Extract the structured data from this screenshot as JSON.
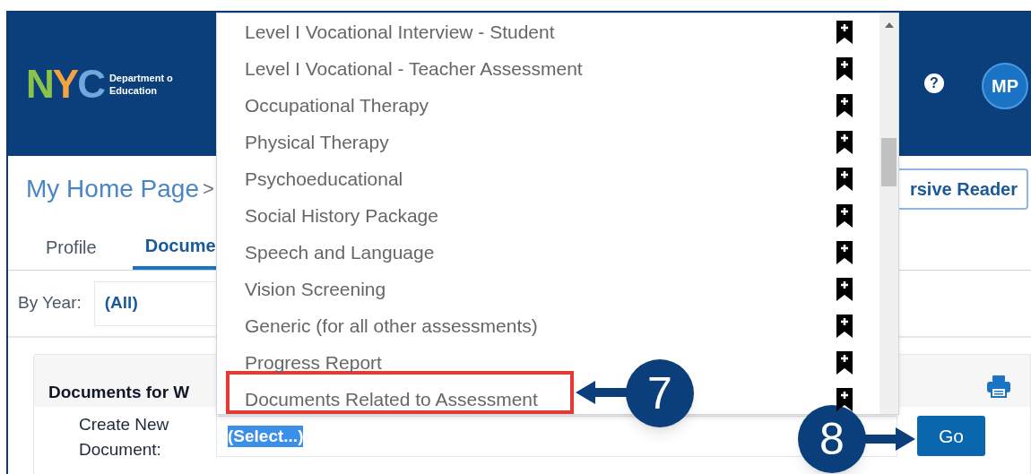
{
  "header": {
    "logo_letters": [
      {
        "letter": "N",
        "color": "#8bc34a"
      },
      {
        "letter": "Y",
        "color": "#f4a340"
      },
      {
        "letter": "C",
        "color": "#6fa8dc"
      }
    ],
    "department_lines": [
      "Department o",
      "Education"
    ],
    "help_icon": "?",
    "avatar": "MP"
  },
  "breadcrumb": {
    "home": "My Home Page",
    "separator": ">",
    "reader_button": "rsive Reader"
  },
  "tabs": [
    {
      "label": "Profile",
      "selected": false
    },
    {
      "label": "Docume",
      "selected": true
    }
  ],
  "filter": {
    "label": "By Year:",
    "value": "(All)"
  },
  "section": {
    "title": "Documents for W",
    "create_label": "Create New Document:",
    "select_value": "(Select...)",
    "go_button": "Go"
  },
  "dropdown": {
    "items": [
      {
        "label": "Level I Vocational Interview - Student"
      },
      {
        "label": "Level I Vocational - Teacher Assessment"
      },
      {
        "label": "Occupational Therapy"
      },
      {
        "label": "Physical Therapy"
      },
      {
        "label": "Psychoeducational"
      },
      {
        "label": "Social History Package"
      },
      {
        "label": "Speech and Language"
      },
      {
        "label": "Vision Screening"
      },
      {
        "label": "Generic (for all other assessments)"
      },
      {
        "label": "Progress Report"
      },
      {
        "label": "Documents Related to Assessment"
      }
    ]
  },
  "callouts": [
    {
      "number": "7"
    },
    {
      "number": "8"
    }
  ]
}
